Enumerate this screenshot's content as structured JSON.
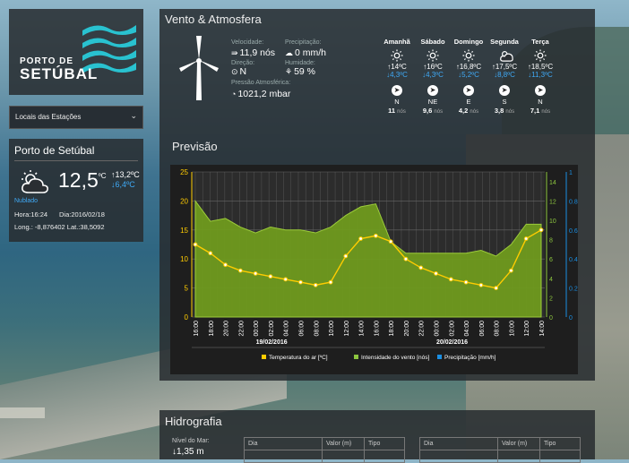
{
  "logo": {
    "line1": "PORTO DE",
    "line2": "SETÚBAL"
  },
  "station_select": {
    "label": "Locais das Estações"
  },
  "port": {
    "title": "Porto de Setúbal",
    "temp": "12,5",
    "temp_unit": "ºC",
    "max": "↑13,2ºC",
    "min": "↓6,4ºC",
    "condition": "Nublado",
    "time": "Hora:16:24",
    "date": "Dia:2016/02/18",
    "coords": "Long.: -8,876402 Lat.:38,5092"
  },
  "wind": {
    "title": "Vento & Atmosfera",
    "speed_label": "Velocidade:",
    "speed": "11,9 nós",
    "direction_label": "Direção:",
    "direction": "N",
    "precip_label": "Precipitação:",
    "precip": "0 mm/h",
    "humidity_label": "Humidade:",
    "humidity": "59 %",
    "pressure_label": "Pressão Atmosférica:",
    "pressure": "1021,2 mbar",
    "forecast": [
      {
        "day": "Amanhã",
        "max": "↑14ºC",
        "min": "↓4,3ºC",
        "dir": "N",
        "speed": "11",
        "unit": "nós",
        "icon": "sun-icon"
      },
      {
        "day": "Sábado",
        "max": "↑16ºC",
        "min": "↓4,3ºC",
        "dir": "NE",
        "speed": "9,6",
        "unit": "nós",
        "icon": "sun-icon"
      },
      {
        "day": "Domingo",
        "max": "↑16,8ºC",
        "min": "↓5,2ºC",
        "dir": "E",
        "speed": "4,2",
        "unit": "nós",
        "icon": "sun-icon"
      },
      {
        "day": "Segunda",
        "max": "↑17,5ºC",
        "min": "↓8,8ºC",
        "dir": "S",
        "speed": "3,8",
        "unit": "nós",
        "icon": "cloud-sun-icon"
      },
      {
        "day": "Terça",
        "max": "↑18,5ºC",
        "min": "↓11,3ºC",
        "dir": "N",
        "speed": "7,1",
        "unit": "nós",
        "icon": "sun-icon"
      }
    ]
  },
  "forecast_section": {
    "title": "Previsão"
  },
  "chart_data": {
    "type": "area",
    "x": [
      "16:00",
      "18:00",
      "20:00",
      "22:00",
      "00:00",
      "02:00",
      "04:00",
      "06:00",
      "08:00",
      "10:00",
      "12:00",
      "14:00",
      "16:00",
      "18:00",
      "20:00",
      "22:00",
      "00:00",
      "02:00",
      "04:00",
      "06:00",
      "08:00",
      "10:00",
      "12:00",
      "14:00"
    ],
    "date_labels": [
      {
        "at": "00:00",
        "index": 4,
        "label": "19/02/2016"
      },
      {
        "at": "00:00",
        "index": 16,
        "label": "20/02/2016"
      }
    ],
    "series": [
      {
        "name": "Temperatura do ar [ºC]",
        "kind": "line",
        "axis": "left",
        "color": "#ffcc00",
        "values": [
          12.5,
          11,
          9,
          8,
          7.5,
          7,
          6.5,
          6,
          5.5,
          6,
          10.5,
          13.5,
          14,
          13,
          10,
          8.5,
          7.5,
          6.5,
          6,
          5.5,
          5,
          8,
          13.5,
          15
        ]
      },
      {
        "name": "Intensidade do vento [nós]",
        "kind": "area",
        "axis": "left",
        "color": "#8dc63f",
        "values": [
          20,
          16.5,
          17,
          15.5,
          14.5,
          15.5,
          15,
          15,
          14.5,
          15.5,
          17.5,
          19,
          19.5,
          13,
          11,
          11,
          11,
          11,
          11,
          11.5,
          10.5,
          12.5,
          16,
          16
        ]
      },
      {
        "name": "Precipitação [mm/h]",
        "kind": "bar",
        "axis": "right2",
        "color": "#1a8fe3",
        "values": [
          0,
          0,
          0,
          0,
          0,
          0,
          0,
          0,
          0,
          0,
          0,
          0,
          0,
          0,
          0,
          0,
          0,
          0,
          0,
          0,
          0,
          0,
          0,
          0
        ]
      }
    ],
    "y_left": {
      "min": 0,
      "max": 25,
      "ticks": [
        0,
        5,
        10,
        15,
        20,
        25
      ]
    },
    "y_right1": {
      "min": 0,
      "max": 15,
      "ticks": [
        0,
        2,
        4,
        6,
        8,
        10,
        12,
        14
      ]
    },
    "y_right2": {
      "min": 0,
      "max": 1.0,
      "ticks": [
        0,
        0.2,
        0.4,
        0.6,
        0.8,
        1
      ]
    },
    "legend_position": "bottom",
    "grid": true
  },
  "hydro": {
    "title": "Hidrografia",
    "level_label": "Nível do Mar:",
    "level": "↓1,35 m",
    "tables": [
      {
        "headers": [
          "Dia",
          "Valor (m)",
          "Tipo"
        ]
      },
      {
        "headers": [
          "Dia",
          "Valor (m)",
          "Tipo"
        ]
      }
    ]
  },
  "colors": {
    "panel": "#2a2e32",
    "accent_blue": "#3fa9f5",
    "wind_green": "#8dc63f",
    "temp_yellow": "#ffcc00"
  }
}
